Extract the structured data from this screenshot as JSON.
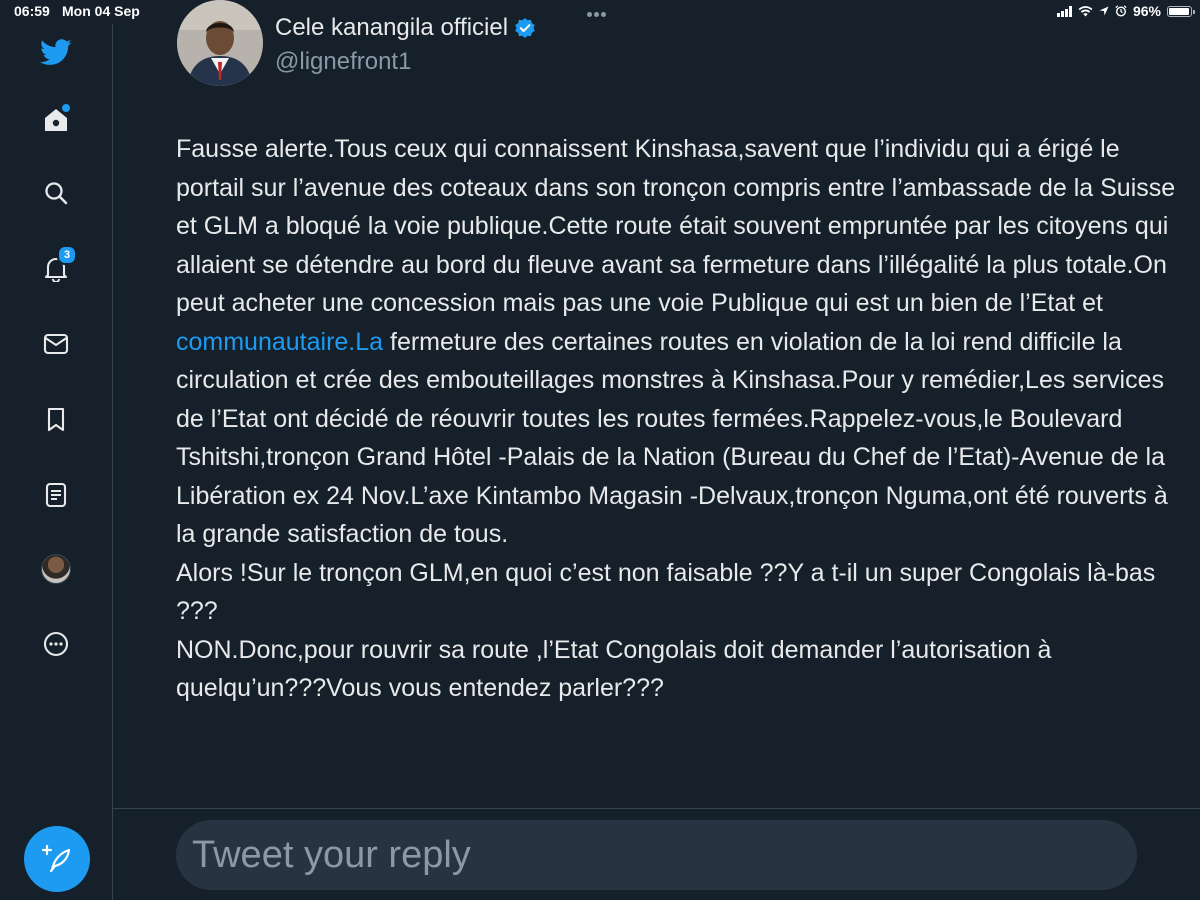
{
  "status_bar": {
    "time": "06:59",
    "date": "Mon 04 Sep",
    "battery_percent": "96%",
    "battery_level": 0.96
  },
  "sidebar": {
    "items": [
      {
        "icon": "twitter-logo-icon"
      },
      {
        "icon": "home-icon",
        "has_dot": true
      },
      {
        "icon": "search-icon"
      },
      {
        "icon": "bell-icon",
        "badge": "3"
      },
      {
        "icon": "mail-icon"
      },
      {
        "icon": "bookmark-icon"
      },
      {
        "icon": "lists-icon"
      },
      {
        "icon": "profile-avatar"
      },
      {
        "icon": "more-icon"
      }
    ],
    "compose_icon": "compose-feather-icon"
  },
  "tweet": {
    "author_name": "Cele kanangila officiel",
    "verified": true,
    "handle": "@lignefront1",
    "text_part1": "Fausse alerte.Tous ceux qui connaissent Kinshasa,savent que l’individu qui a érigé le portail sur l’avenue des coteaux dans son tronçon compris entre l’ambassade de la Suisse et GLM a bloqué la voie publique.Cette route était souvent empruntée par les citoyens qui allaient se détendre au bord du fleuve avant sa fermeture dans l’illégalité la plus totale.On peut acheter une concession mais pas une voie Publique qui est un bien de l’Etat et ",
    "link_text": "communautaire.La",
    "text_part2": " fermeture des certaines routes en violation de la loi rend difficile la circulation et crée des embouteillages monstres à Kinshasa.Pour y remédier,Les services de l’Etat ont décidé de réouvrir toutes les routes fermées.Rappelez-vous,le Boulevard Tshitshi,tronçon Grand Hôtel -Palais de la Nation (Bureau du Chef de l’Etat)-Avenue de la Libération ex 24 Nov.L’axe Kintambo Magasin -Delvaux,tronçon Nguma,ont été rouverts à la grande satisfaction de tous.",
    "text_para2": "Alors !Sur le tronçon GLM,en quoi c’est non faisable ??Y a t-il un super Congolais là-bas ???",
    "text_para3": "NON.Donc,pour rouvrir sa route ,l’Etat Congolais doit demander l’autorisation à quelqu’un???Vous vous entendez parler???"
  },
  "reply": {
    "placeholder": "Tweet your reply"
  },
  "colors": {
    "background": "#15202b",
    "accent": "#1d9bf0",
    "text": "#e7e9ea",
    "muted": "#8b98a5"
  }
}
